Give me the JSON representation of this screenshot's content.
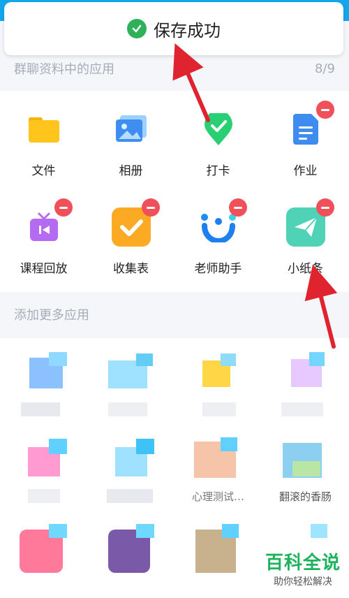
{
  "toast": {
    "text": "保存成功"
  },
  "group_apps": {
    "header": "群聊资料中的应用",
    "count": "8/9",
    "items": [
      {
        "label": "文件",
        "icon": "folder-icon",
        "removable": false
      },
      {
        "label": "相册",
        "icon": "album-icon",
        "removable": false
      },
      {
        "label": "打卡",
        "icon": "checkin-icon",
        "removable": false
      },
      {
        "label": "作业",
        "icon": "homework-icon",
        "removable": true
      },
      {
        "label": "课程回放",
        "icon": "course-replay-icon",
        "removable": true
      },
      {
        "label": "收集表",
        "icon": "collect-form-icon",
        "removable": true
      },
      {
        "label": "老师助手",
        "icon": "teacher-assistant-icon",
        "removable": true
      },
      {
        "label": "小纸条",
        "icon": "paper-plane-icon",
        "removable": true
      }
    ]
  },
  "more_apps": {
    "header": "添加更多应用",
    "visible_labels": [
      "心理测试…",
      "翻滚的香肠"
    ]
  },
  "watermark": {
    "main": "百科全说",
    "sub": "助你轻松解决"
  },
  "colors": {
    "accent": "#12a7ec",
    "danger": "#f0505a",
    "success": "#2fb15a",
    "arrow": "#e0242f"
  }
}
